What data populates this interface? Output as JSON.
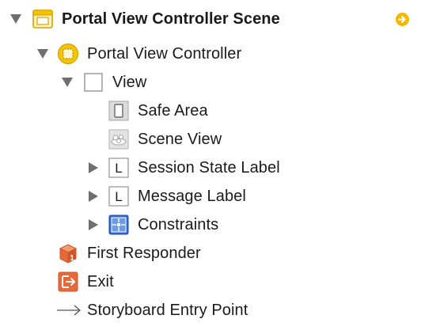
{
  "outline": {
    "scene_label": "Portal View Controller Scene",
    "controller_label": "Portal View Controller",
    "view_label": "View",
    "safe_area_label": "Safe Area",
    "scene_view_label": "Scene View",
    "session_state_label": "Session State Label",
    "message_label": "Message Label",
    "constraints_label": "Constraints",
    "first_responder_label": "First Responder",
    "exit_label": "Exit",
    "entry_point_label": "Storyboard Entry Point",
    "label_glyph": "L",
    "first_responder_badge": "1"
  },
  "icons": {
    "scene": "scene-icon",
    "controller": "view-controller-icon",
    "view": "view-icon",
    "safe_area": "safe-area-icon",
    "scene_view": "scene-view-icon",
    "label": "label-icon",
    "constraints": "constraints-icon",
    "first_responder": "first-responder-icon",
    "exit": "exit-icon",
    "entry_point": "arrow-right-icon",
    "navigate": "navigate-arrow-icon"
  },
  "colors": {
    "accent_yellow": "#f5b800",
    "disclosure_gray": "#6f6f6f",
    "exit_orange": "#e8683a",
    "constraints_blue": "#2f6bd1"
  }
}
